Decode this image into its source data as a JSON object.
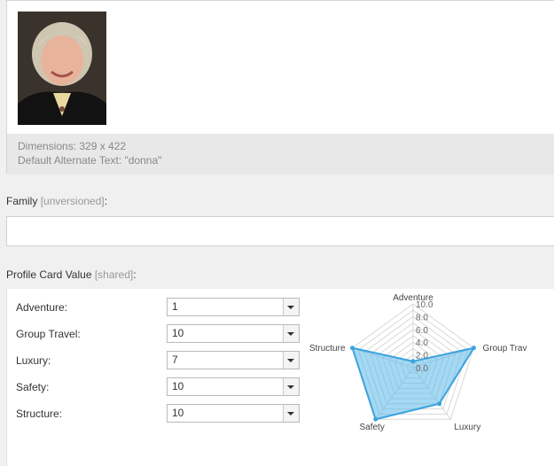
{
  "image_info": {
    "dimensions": "Dimensions: 329 x 422",
    "alt_text": "Default Alternate Text: \"donna\""
  },
  "family": {
    "label": "Family",
    "note": "[unversioned]",
    "suffix": ":",
    "value": ""
  },
  "profile": {
    "label": "Profile Card Value",
    "note": "[shared]",
    "suffix": ":",
    "fields": [
      {
        "label": "Adventure:",
        "value": "1"
      },
      {
        "label": "Group Travel:",
        "value": "10"
      },
      {
        "label": "Luxury:",
        "value": "7"
      },
      {
        "label": "Safety:",
        "value": "10"
      },
      {
        "label": "Structure:",
        "value": "10"
      }
    ]
  },
  "chart_data": {
    "type": "radar",
    "categories": [
      "Adventure",
      "Group Trav",
      "Luxury",
      "Safety",
      "Structure"
    ],
    "values": [
      1,
      10,
      7,
      10,
      10
    ],
    "scale_labels": [
      "10.0",
      "8.0",
      "6.0",
      "4.0",
      "2.0",
      "0.0"
    ],
    "range": [
      0,
      10
    ],
    "fill_color": "#5bb8e8",
    "stroke_color": "#3aa3dd"
  }
}
